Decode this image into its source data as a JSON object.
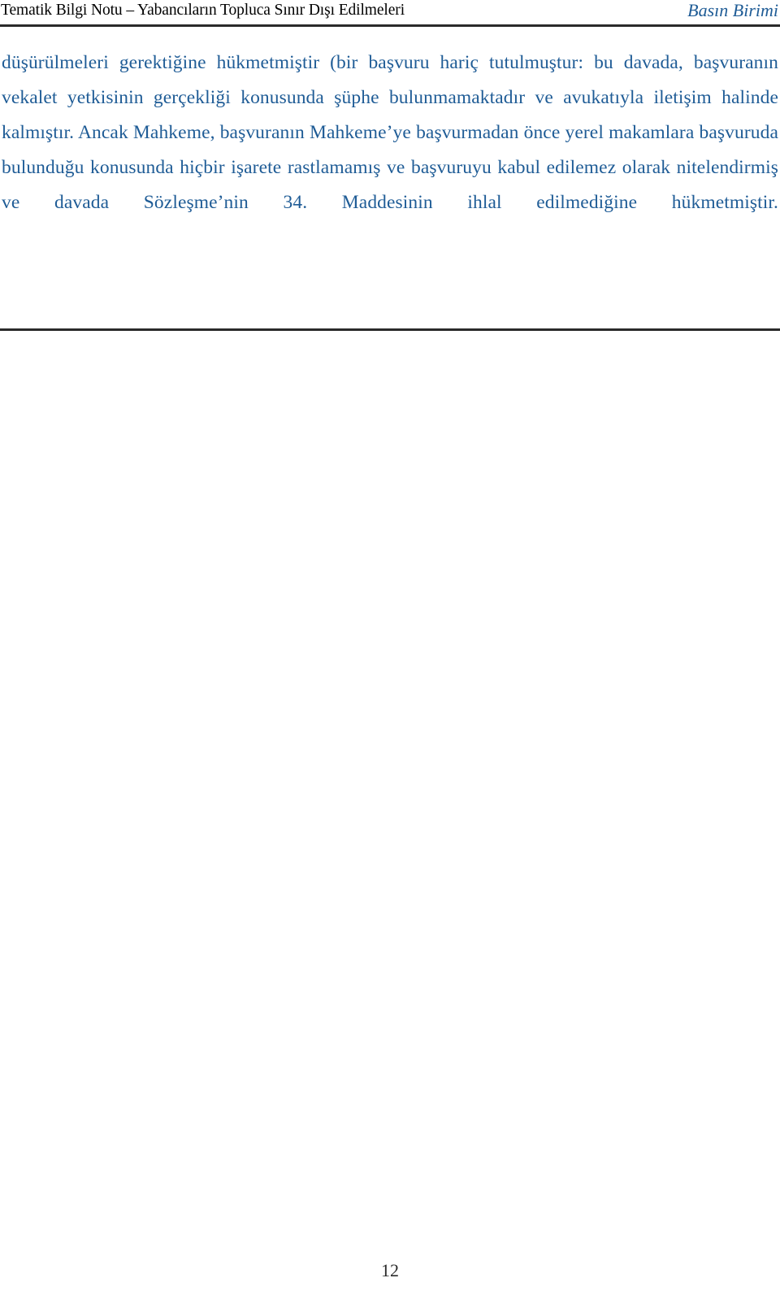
{
  "header": {
    "title": "Tematik Bilgi Notu – Yabancıların Topluca Sınır Dışı Edilmeleri",
    "unit": "Basın Birimi",
    "title_color": "#000000",
    "unit_color": "#1F5C96",
    "rule_color": "#2A2A2A"
  },
  "body": {
    "text_color": "#1F5C96",
    "paragraph": "düşürülmeleri gerektiğine hükmetmiştir (bir başvuru hariç tutulmuştur: bu davada, başvuranın vekalet yetkisinin gerçekliği konusunda şüphe bulunmamaktadır ve avukatıyla iletişim halinde kalmıştır. Ancak Mahkeme, başvuranın Mahkeme’ye başvurmadan önce yerel makamlara başvuruda bulunduğu konusunda hiçbir işarete rastlamamış ve başvuruyu kabul edilemez olarak nitelendirmiş ve davada Sözleşme’nin 34. Maddesinin ihlal edilmediğine hükmetmiştir."
  },
  "footer": {
    "page_number": "12",
    "color": "#2B2B2B"
  }
}
